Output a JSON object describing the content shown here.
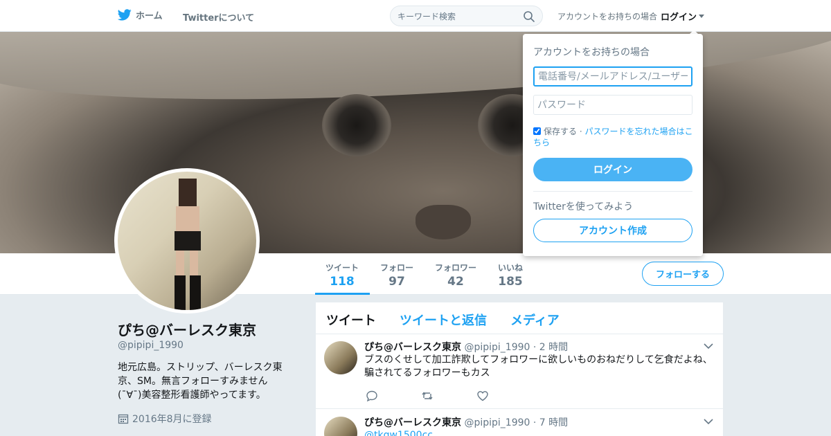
{
  "topbar": {
    "home_label": "ホーム",
    "about_label": "Twitterについて",
    "search_placeholder": "キーワード検索",
    "login_prompt": "アカウントをお持ちの場合",
    "login_label": "ログイン"
  },
  "colors": {
    "brand": "#1da1f2",
    "text": "#14171a",
    "muted": "#657786",
    "background": "#e6ecf0"
  },
  "stats": [
    {
      "label": "ツイート",
      "value": "118",
      "active": true
    },
    {
      "label": "フォロー",
      "value": "97"
    },
    {
      "label": "フォロワー",
      "value": "42"
    },
    {
      "label": "いいね",
      "value": "185"
    }
  ],
  "follow_button": "フォローする",
  "profile": {
    "name": "ぴち@バーレスク東京",
    "handle": "@pipipi_1990",
    "bio": "地元広島。ストリップ、バーレスク東京、SM。無言フォローすみません(¯∀¯)美容整形看護師やってます。",
    "joined": "2016年8月に登録"
  },
  "timeline": {
    "tabs": [
      "ツイート",
      "ツイートと返信",
      "メディア"
    ],
    "tweets": [
      {
        "name": "ぴち@バーレスク東京",
        "handle": "@pipipi_1990",
        "time": "· 2 時間",
        "text": "ブスのくせして加工詐欺してフォロワーに欲しいものおねだりして乞食だよね、騙されてるフォロワーもカス"
      },
      {
        "name": "ぴち@バーレスク東京",
        "handle": "@pipipi_1990",
        "time": "· 7 時間",
        "text": "@tkgw1500cc"
      }
    ]
  },
  "login_dropdown": {
    "heading": "アカウントをお持ちの場合",
    "username_placeholder": "電話番号/メールアドレス/ユーザー名",
    "password_placeholder": "パスワード",
    "remember_label": "保存する",
    "separator": "·",
    "forgot_link": "パスワードを忘れた場合はこちら",
    "login_button": "ログイン",
    "try_label": "Twitterを使ってみよう",
    "signup_button": "アカウント作成"
  }
}
